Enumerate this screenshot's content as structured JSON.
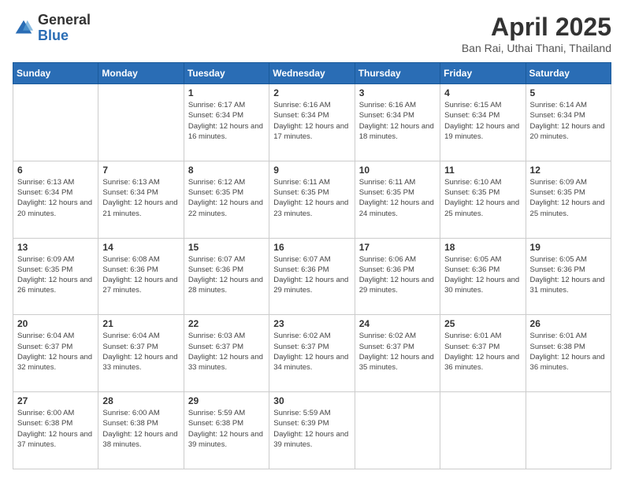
{
  "logo": {
    "general": "General",
    "blue": "Blue"
  },
  "header": {
    "title": "April 2025",
    "subtitle": "Ban Rai, Uthai Thani, Thailand"
  },
  "weekdays": [
    "Sunday",
    "Monday",
    "Tuesday",
    "Wednesday",
    "Thursday",
    "Friday",
    "Saturday"
  ],
  "weeks": [
    [
      {
        "day": "",
        "sunrise": "",
        "sunset": "",
        "daylight": ""
      },
      {
        "day": "",
        "sunrise": "",
        "sunset": "",
        "daylight": ""
      },
      {
        "day": "1",
        "sunrise": "Sunrise: 6:17 AM",
        "sunset": "Sunset: 6:34 PM",
        "daylight": "Daylight: 12 hours and 16 minutes."
      },
      {
        "day": "2",
        "sunrise": "Sunrise: 6:16 AM",
        "sunset": "Sunset: 6:34 PM",
        "daylight": "Daylight: 12 hours and 17 minutes."
      },
      {
        "day": "3",
        "sunrise": "Sunrise: 6:16 AM",
        "sunset": "Sunset: 6:34 PM",
        "daylight": "Daylight: 12 hours and 18 minutes."
      },
      {
        "day": "4",
        "sunrise": "Sunrise: 6:15 AM",
        "sunset": "Sunset: 6:34 PM",
        "daylight": "Daylight: 12 hours and 19 minutes."
      },
      {
        "day": "5",
        "sunrise": "Sunrise: 6:14 AM",
        "sunset": "Sunset: 6:34 PM",
        "daylight": "Daylight: 12 hours and 20 minutes."
      }
    ],
    [
      {
        "day": "6",
        "sunrise": "Sunrise: 6:13 AM",
        "sunset": "Sunset: 6:34 PM",
        "daylight": "Daylight: 12 hours and 20 minutes."
      },
      {
        "day": "7",
        "sunrise": "Sunrise: 6:13 AM",
        "sunset": "Sunset: 6:34 PM",
        "daylight": "Daylight: 12 hours and 21 minutes."
      },
      {
        "day": "8",
        "sunrise": "Sunrise: 6:12 AM",
        "sunset": "Sunset: 6:35 PM",
        "daylight": "Daylight: 12 hours and 22 minutes."
      },
      {
        "day": "9",
        "sunrise": "Sunrise: 6:11 AM",
        "sunset": "Sunset: 6:35 PM",
        "daylight": "Daylight: 12 hours and 23 minutes."
      },
      {
        "day": "10",
        "sunrise": "Sunrise: 6:11 AM",
        "sunset": "Sunset: 6:35 PM",
        "daylight": "Daylight: 12 hours and 24 minutes."
      },
      {
        "day": "11",
        "sunrise": "Sunrise: 6:10 AM",
        "sunset": "Sunset: 6:35 PM",
        "daylight": "Daylight: 12 hours and 25 minutes."
      },
      {
        "day": "12",
        "sunrise": "Sunrise: 6:09 AM",
        "sunset": "Sunset: 6:35 PM",
        "daylight": "Daylight: 12 hours and 25 minutes."
      }
    ],
    [
      {
        "day": "13",
        "sunrise": "Sunrise: 6:09 AM",
        "sunset": "Sunset: 6:35 PM",
        "daylight": "Daylight: 12 hours and 26 minutes."
      },
      {
        "day": "14",
        "sunrise": "Sunrise: 6:08 AM",
        "sunset": "Sunset: 6:36 PM",
        "daylight": "Daylight: 12 hours and 27 minutes."
      },
      {
        "day": "15",
        "sunrise": "Sunrise: 6:07 AM",
        "sunset": "Sunset: 6:36 PM",
        "daylight": "Daylight: 12 hours and 28 minutes."
      },
      {
        "day": "16",
        "sunrise": "Sunrise: 6:07 AM",
        "sunset": "Sunset: 6:36 PM",
        "daylight": "Daylight: 12 hours and 29 minutes."
      },
      {
        "day": "17",
        "sunrise": "Sunrise: 6:06 AM",
        "sunset": "Sunset: 6:36 PM",
        "daylight": "Daylight: 12 hours and 29 minutes."
      },
      {
        "day": "18",
        "sunrise": "Sunrise: 6:05 AM",
        "sunset": "Sunset: 6:36 PM",
        "daylight": "Daylight: 12 hours and 30 minutes."
      },
      {
        "day": "19",
        "sunrise": "Sunrise: 6:05 AM",
        "sunset": "Sunset: 6:36 PM",
        "daylight": "Daylight: 12 hours and 31 minutes."
      }
    ],
    [
      {
        "day": "20",
        "sunrise": "Sunrise: 6:04 AM",
        "sunset": "Sunset: 6:37 PM",
        "daylight": "Daylight: 12 hours and 32 minutes."
      },
      {
        "day": "21",
        "sunrise": "Sunrise: 6:04 AM",
        "sunset": "Sunset: 6:37 PM",
        "daylight": "Daylight: 12 hours and 33 minutes."
      },
      {
        "day": "22",
        "sunrise": "Sunrise: 6:03 AM",
        "sunset": "Sunset: 6:37 PM",
        "daylight": "Daylight: 12 hours and 33 minutes."
      },
      {
        "day": "23",
        "sunrise": "Sunrise: 6:02 AM",
        "sunset": "Sunset: 6:37 PM",
        "daylight": "Daylight: 12 hours and 34 minutes."
      },
      {
        "day": "24",
        "sunrise": "Sunrise: 6:02 AM",
        "sunset": "Sunset: 6:37 PM",
        "daylight": "Daylight: 12 hours and 35 minutes."
      },
      {
        "day": "25",
        "sunrise": "Sunrise: 6:01 AM",
        "sunset": "Sunset: 6:37 PM",
        "daylight": "Daylight: 12 hours and 36 minutes."
      },
      {
        "day": "26",
        "sunrise": "Sunrise: 6:01 AM",
        "sunset": "Sunset: 6:38 PM",
        "daylight": "Daylight: 12 hours and 36 minutes."
      }
    ],
    [
      {
        "day": "27",
        "sunrise": "Sunrise: 6:00 AM",
        "sunset": "Sunset: 6:38 PM",
        "daylight": "Daylight: 12 hours and 37 minutes."
      },
      {
        "day": "28",
        "sunrise": "Sunrise: 6:00 AM",
        "sunset": "Sunset: 6:38 PM",
        "daylight": "Daylight: 12 hours and 38 minutes."
      },
      {
        "day": "29",
        "sunrise": "Sunrise: 5:59 AM",
        "sunset": "Sunset: 6:38 PM",
        "daylight": "Daylight: 12 hours and 39 minutes."
      },
      {
        "day": "30",
        "sunrise": "Sunrise: 5:59 AM",
        "sunset": "Sunset: 6:39 PM",
        "daylight": "Daylight: 12 hours and 39 minutes."
      },
      {
        "day": "",
        "sunrise": "",
        "sunset": "",
        "daylight": ""
      },
      {
        "day": "",
        "sunrise": "",
        "sunset": "",
        "daylight": ""
      },
      {
        "day": "",
        "sunrise": "",
        "sunset": "",
        "daylight": ""
      }
    ]
  ]
}
